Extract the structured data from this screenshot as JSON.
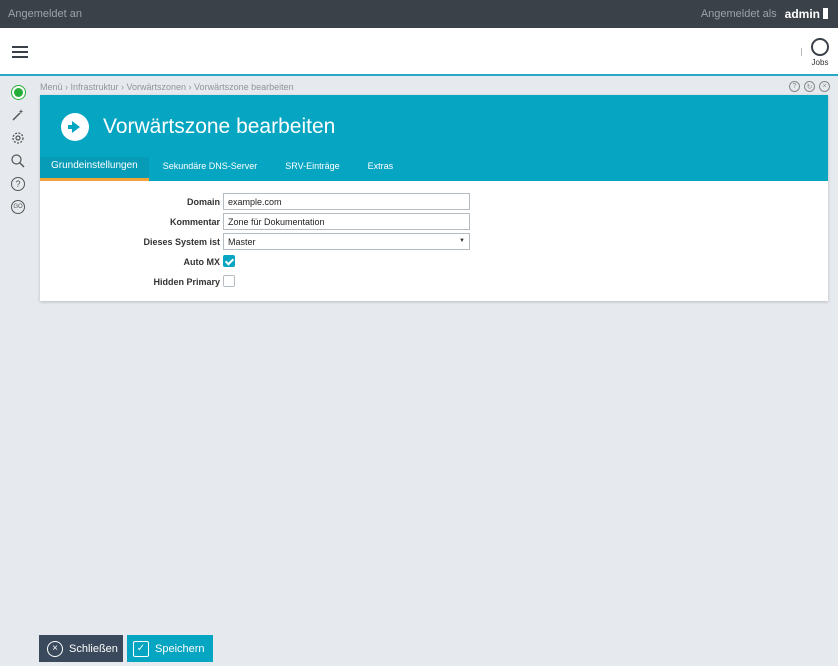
{
  "topbar": {
    "left_text": "Angemeldet an",
    "logged_in_as": "Angemeldet als",
    "username": "admin"
  },
  "header": {
    "jobs_label": "Jobs"
  },
  "breadcrumb": "Menü › Infrastruktur › Vorwärtszonen › Vorwärtszone bearbeiten",
  "panel": {
    "title": "Vorwärtszone bearbeiten",
    "tabs": [
      {
        "label": "Grundeinstellungen",
        "active": true
      },
      {
        "label": "Sekundäre DNS-Server",
        "active": false
      },
      {
        "label": "SRV-Einträge",
        "active": false
      },
      {
        "label": "Extras",
        "active": false
      }
    ]
  },
  "form": {
    "domain_label": "Domain",
    "domain_value": "example.com",
    "comment_label": "Kommentar",
    "comment_value": "Zone für Dokumentation",
    "system_label": "Dieses System ist",
    "system_value": "Master",
    "automx_label": "Auto MX",
    "automx_checked": true,
    "hidden_label": "Hidden Primary",
    "hidden_checked": false
  },
  "footer": {
    "close_label": "Schließen",
    "save_label": "Speichern"
  },
  "colors": {
    "accent": "#06a5c2",
    "topbar": "#3a4149",
    "tab_indicator": "#f2a33a",
    "status_green": "#27ae3a"
  }
}
